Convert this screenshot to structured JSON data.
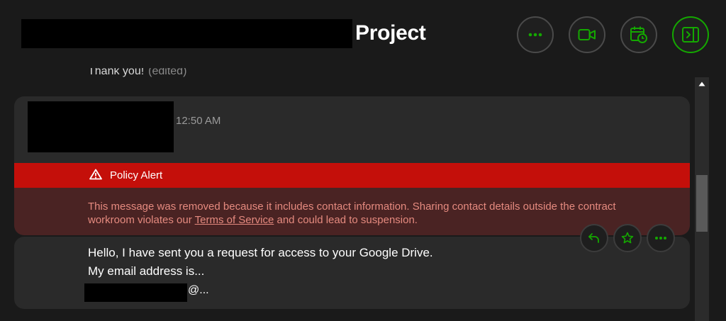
{
  "header": {
    "title_suffix": "Project",
    "buttons": [
      {
        "name": "more-options",
        "icon": "ellipsis-icon"
      },
      {
        "name": "video-call",
        "icon": "video-camera-icon"
      },
      {
        "name": "schedule",
        "icon": "calendar-clock-icon"
      },
      {
        "name": "toggle-sidebar",
        "icon": "sidebar-panel-icon"
      }
    ],
    "accent_color": "#14a800"
  },
  "chat": {
    "previous_message": {
      "text": "Thank you!",
      "status": "(edited)"
    },
    "message": {
      "timestamp": "12:50 AM",
      "alert": {
        "title": "Policy Alert",
        "body_before_link": "This message was removed because it includes contact information. Sharing contact details outside the contract workroom violates our ",
        "link_text": "Terms of Service",
        "body_after_link": " and could lead to suspension.",
        "bar_color": "#c40f0a",
        "body_color": "#4a2323"
      }
    },
    "next_message": {
      "line1": "Hello, I have sent you a request for access to your Google Drive.",
      "line2": "My email address is...",
      "email_suffix": "@..."
    },
    "message_actions": [
      {
        "name": "reply",
        "icon": "reply-arrow-icon"
      },
      {
        "name": "favorite",
        "icon": "star-icon"
      },
      {
        "name": "more",
        "icon": "ellipsis-icon"
      }
    ]
  }
}
